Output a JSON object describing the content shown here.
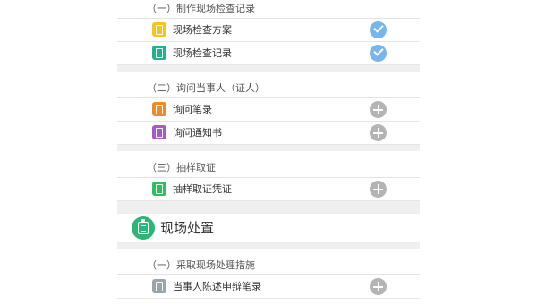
{
  "sections": [
    {
      "groups": [
        {
          "title": "（一）制作现场检查记录",
          "items": [
            {
              "label": "现场检查方案",
              "icon": "document-icon",
              "color": "#f4c51f",
              "status": "checked"
            },
            {
              "label": "现场检查记录",
              "icon": "document-icon",
              "color": "#23b08f",
              "status": "checked"
            }
          ]
        },
        {
          "title": "（二）询问当事人（证人）",
          "items": [
            {
              "label": "询问笔录",
              "icon": "document-icon",
              "color": "#ef8a2a",
              "status": "add"
            },
            {
              "label": "询问通知书",
              "icon": "document-icon",
              "color": "#a55bc4",
              "status": "add"
            }
          ]
        },
        {
          "title": "（三）抽样取证",
          "items": [
            {
              "label": "抽样取证凭证",
              "icon": "document-icon",
              "color": "#2fbf5e",
              "status": "add"
            }
          ]
        }
      ]
    },
    {
      "title": "现场处置",
      "icon": "clipboard-icon",
      "icon_color": "#2bb673",
      "groups": [
        {
          "title": "（一）采取现场处理措施",
          "items": [
            {
              "label": "当事人陈述申辩笔录",
              "icon": "document-icon",
              "color": "#9aa5ab",
              "status": "add"
            }
          ]
        }
      ]
    }
  ],
  "colors": {
    "checked": "#78b5ea",
    "add": "#b4b4b4",
    "separator": "#efefef"
  }
}
